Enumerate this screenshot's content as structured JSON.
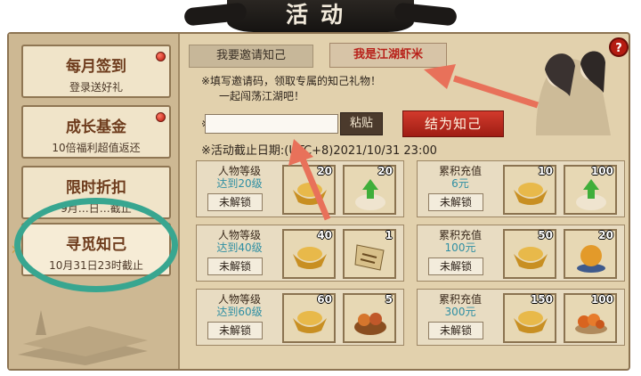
{
  "title": "活动",
  "sidebar": {
    "items": [
      {
        "title": "每月签到",
        "subtitle": "登录送好礼"
      },
      {
        "title": "成长基金",
        "subtitle": "10倍福利超值返还"
      },
      {
        "title": "限时折扣",
        "subtitle": "9月…日…截止"
      },
      {
        "title": "寻觅知己",
        "subtitle": "10月31日23时截止"
      }
    ]
  },
  "tabs": {
    "invite": "我要邀请知己",
    "me": "我是江湖虾米"
  },
  "notes": {
    "line1": "※填写邀请码，领取专属的知己礼物！",
    "line2": "一起闯荡江湖吧！",
    "input_marker": "※",
    "deadline": "※活动截止日期:(UTC+8)2021/10/31 23:00"
  },
  "buttons": {
    "paste": "粘贴",
    "bind": "结为知己",
    "help": "?"
  },
  "lock_label": "未解锁",
  "level_cards": [
    {
      "line1": "人物等级",
      "line2": "达到20级",
      "items": [
        {
          "icon": "gold-ingot",
          "count": "20"
        },
        {
          "icon": "upgrade-bun",
          "count": "20"
        }
      ]
    },
    {
      "line1": "人物等级",
      "line2": "达到40级",
      "items": [
        {
          "icon": "gold-ingot",
          "count": "40"
        },
        {
          "icon": "scroll-ticket",
          "count": "1"
        }
      ]
    },
    {
      "line1": "人物等级",
      "line2": "达到60级",
      "items": [
        {
          "icon": "gold-ingot",
          "count": "60"
        },
        {
          "icon": "food-basket",
          "count": "5"
        }
      ]
    }
  ],
  "recharge_cards": [
    {
      "line1": "累积充值",
      "line2": "6元",
      "items": [
        {
          "icon": "gold-ingot",
          "count": "10"
        },
        {
          "icon": "upgrade-bun",
          "count": "100"
        }
      ]
    },
    {
      "line1": "累积充值",
      "line2": "100元",
      "items": [
        {
          "icon": "gold-ingot",
          "count": "50"
        },
        {
          "icon": "orange-orb",
          "count": "20"
        }
      ]
    },
    {
      "line1": "累积充值",
      "line2": "300元",
      "items": [
        {
          "icon": "gold-ingot",
          "count": "150"
        },
        {
          "icon": "fruit-plate",
          "count": "100"
        }
      ]
    }
  ],
  "colors": {
    "panel": "#e2d1ad",
    "accent_red": "#b8211a",
    "highlight_teal": "#38a690",
    "arrow": "#e8715a"
  }
}
